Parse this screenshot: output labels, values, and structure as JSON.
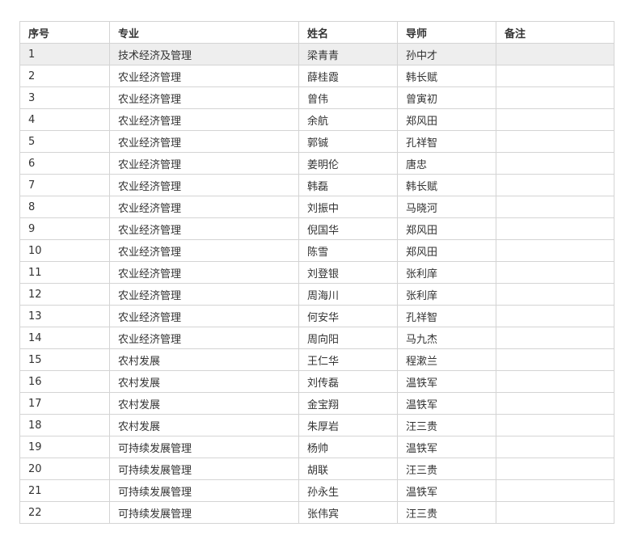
{
  "table": {
    "headers": [
      "序号",
      "专业",
      "姓名",
      "导师",
      "备注"
    ],
    "rows": [
      [
        "1",
        "技术经济及管理",
        "梁青青",
        "孙中才",
        ""
      ],
      [
        "2",
        "农业经济管理",
        "薛桂霞",
        "韩长赋",
        ""
      ],
      [
        "3",
        "农业经济管理",
        "曾伟",
        "曾寅初",
        ""
      ],
      [
        "4",
        "农业经济管理",
        "余航",
        "郑风田",
        ""
      ],
      [
        "5",
        "农业经济管理",
        "郭铖",
        "孔祥智",
        ""
      ],
      [
        "6",
        "农业经济管理",
        "姜明伦",
        "唐忠",
        ""
      ],
      [
        "7",
        "农业经济管理",
        "韩磊",
        "韩长赋",
        ""
      ],
      [
        "8",
        "农业经济管理",
        "刘振中",
        "马晓河",
        ""
      ],
      [
        "9",
        "农业经济管理",
        "倪国华",
        "郑风田",
        ""
      ],
      [
        "10",
        "农业经济管理",
        "陈雪",
        "郑风田",
        ""
      ],
      [
        "11",
        "农业经济管理",
        "刘登银",
        "张利庠",
        ""
      ],
      [
        "12",
        "农业经济管理",
        "周海川",
        "张利庠",
        ""
      ],
      [
        "13",
        "农业经济管理",
        "何安华",
        "孔祥智",
        ""
      ],
      [
        "14",
        "农业经济管理",
        "周向阳",
        "马九杰",
        ""
      ],
      [
        "15",
        "农村发展",
        "王仁华",
        "程漱兰",
        ""
      ],
      [
        "16",
        "农村发展",
        "刘传磊",
        "温铁军",
        ""
      ],
      [
        "17",
        "农村发展",
        "金宝翔",
        "温铁军",
        ""
      ],
      [
        "18",
        "农村发展",
        "朱厚岩",
        "汪三贵",
        ""
      ],
      [
        "19",
        "可持续发展管理",
        "杨帅",
        "温铁军",
        ""
      ],
      [
        "20",
        "可持续发展管理",
        "胡联",
        "汪三贵",
        ""
      ],
      [
        "21",
        "可持续发展管理",
        "孙永生",
        "温铁军",
        ""
      ],
      [
        "22",
        "可持续发展管理",
        "张伟宾",
        "汪三贵",
        ""
      ]
    ],
    "highlight_row_index": 0,
    "colors": {
      "border": "#d4d4d4",
      "highlight_bg": "#eeeeee",
      "text": "#333333"
    }
  }
}
